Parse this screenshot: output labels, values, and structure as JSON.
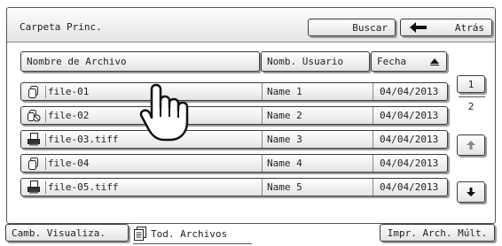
{
  "header": {
    "folder_path": "Carpeta Princ.",
    "search_label": "Buscar",
    "back_label": "Atrás"
  },
  "columns": {
    "file_name": "Nombre de Archivo",
    "user_name": "Nomb. Usuario",
    "date": "Fecha",
    "date_sort": "ascending"
  },
  "files": [
    {
      "icon": "copy-doc-icon",
      "name": "file-01",
      "user": "Name 1",
      "date": "04/04/2013"
    },
    {
      "icon": "copy-no-icon",
      "name": "file-02",
      "user": "Name 2",
      "date": "04/04/2013"
    },
    {
      "icon": "printer-icon",
      "name": "file-03.tiff",
      "user": "Name 3",
      "date": "04/04/2013"
    },
    {
      "icon": "copy-doc-icon",
      "name": "file-04",
      "user": "Name 4",
      "date": "04/04/2013"
    },
    {
      "icon": "printer-icon",
      "name": "file-05.tiff",
      "user": "Name 5",
      "date": "04/04/2013"
    }
  ],
  "pagination": {
    "current": "1",
    "total": "2"
  },
  "footer": {
    "view_label": "Camb. Visualiza.",
    "all_files_label": "Tod. Archivos",
    "print_label": "Impr. Arch. Múlt."
  },
  "pointer": "hand-pointer-icon"
}
